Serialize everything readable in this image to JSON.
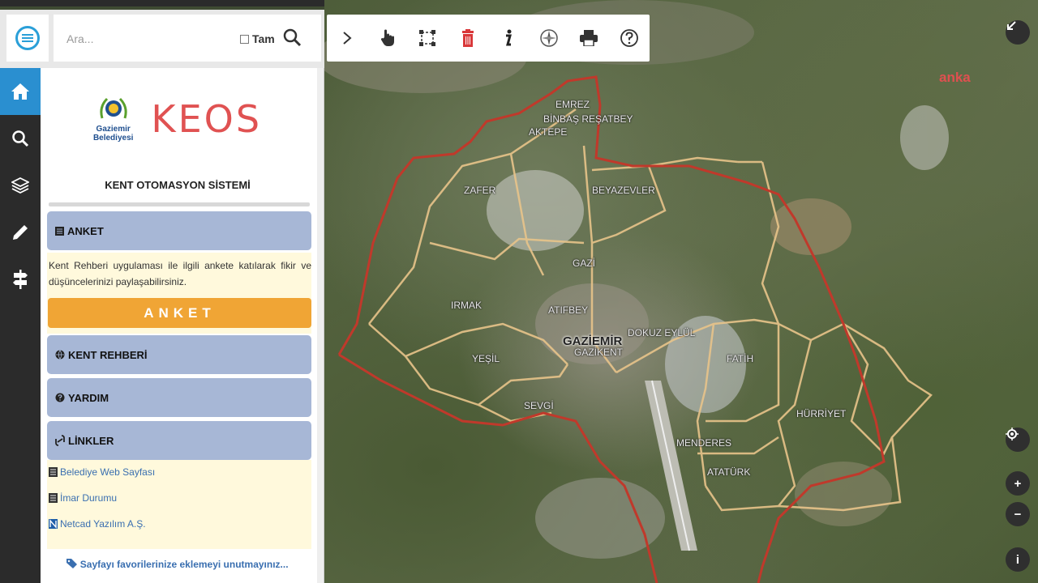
{
  "search": {
    "placeholder": "Ara...",
    "exact_label": "Tam"
  },
  "iconbar": {
    "items": [
      {
        "name": "home-icon",
        "active": true
      },
      {
        "name": "search-icon",
        "active": false
      },
      {
        "name": "layers-icon",
        "active": false
      },
      {
        "name": "pencil-icon",
        "active": false
      },
      {
        "name": "signpost-icon",
        "active": false
      }
    ]
  },
  "panel": {
    "logo_text_line1": "Gaziemir",
    "logo_text_line2": "Belediyesi",
    "brand": "KEOS",
    "title": "KENT OTOMASYON SİSTEMİ",
    "anket_header": "ANKET",
    "anket_text": "Kent Rehberi uygulaması ile ilgili ankete katılarak fikir ve düşüncelerinizi paylaşabilirsiniz.",
    "anket_button": "ANKET",
    "kent_rehberi_header": "KENT REHBERİ",
    "yardim_header": "YARDIM",
    "linkler_header": "LİNKLER",
    "links": [
      "Belediye Web Sayfası",
      "İmar Durumu",
      "Netcad Yazılım A.Ş."
    ],
    "favorites_note": "Sayfayı favorilerinize eklemeyi unutmayınız..."
  },
  "toolbar": {
    "tools": [
      "arrow-right-icon",
      "hand-icon",
      "select-box-icon",
      "trash-icon",
      "info-icon",
      "compass-icon",
      "print-icon",
      "help-icon"
    ]
  },
  "map": {
    "labels": [
      "EMREZ",
      "BİNBAŞ REŞATBEY",
      "AKTEPE",
      "ZAFER",
      "BEYAZEVLER",
      "GAZİ",
      "IRMAK",
      "ATIFBEY",
      "DOKUZ EYLÜL",
      "GAZİEMİR",
      "GAZİKENT",
      "YEŞİL",
      "SEVGİ",
      "FATİH",
      "HÜRRİYET",
      "MENDERES",
      "ATATÜRK",
      "anka"
    ],
    "controls": [
      "collapse-icon",
      "locate-icon",
      "zoom-in",
      "zoom-out",
      "info"
    ],
    "zoom_in": "+",
    "zoom_out": "−",
    "info": "i"
  },
  "colors": {
    "accent": "#2a8fd0",
    "brand_red": "#e05252",
    "accordion": "#a7b7d6",
    "anket_button": "#f0a535",
    "boundary_red": "#c0392b",
    "boundary_tan": "#e8c48a"
  }
}
